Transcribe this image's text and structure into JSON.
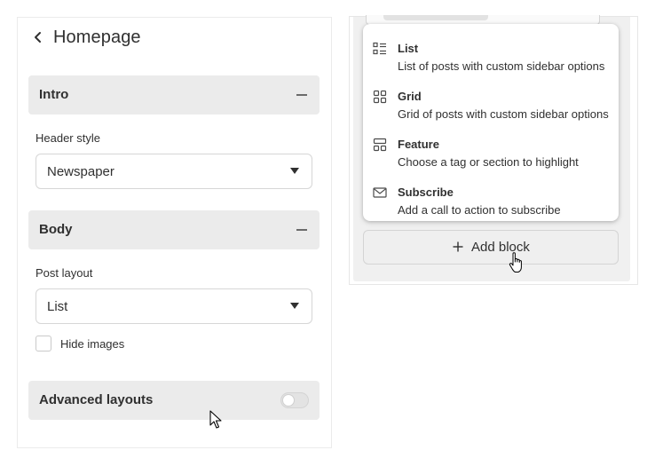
{
  "left_panel": {
    "title": "Homepage",
    "intro": {
      "title": "Intro",
      "header_style_label": "Header style",
      "header_style_value": "Newspaper"
    },
    "body": {
      "title": "Body",
      "post_layout_label": "Post layout",
      "post_layout_value": "List",
      "hide_images_label": "Hide images",
      "hide_images_checked": false
    },
    "advanced": {
      "title": "Advanced layouts",
      "toggle_on": false
    }
  },
  "block_menu": {
    "items": [
      {
        "icon": "list-icon",
        "title": "List",
        "description": "List of posts with custom sidebar options"
      },
      {
        "icon": "grid-icon",
        "title": "Grid",
        "description": "Grid of posts with custom sidebar options"
      },
      {
        "icon": "feature-icon",
        "title": "Feature",
        "description": "Choose a tag or section to highlight"
      },
      {
        "icon": "mail-icon",
        "title": "Subscribe",
        "description": "Add a call to action to subscribe"
      }
    ]
  },
  "add_block": {
    "label": "Add block"
  },
  "colors": {
    "section_bg": "#ebebeb",
    "panel_bg": "#f0f0f0",
    "text": "#303030",
    "border": "#d4d4d4"
  }
}
